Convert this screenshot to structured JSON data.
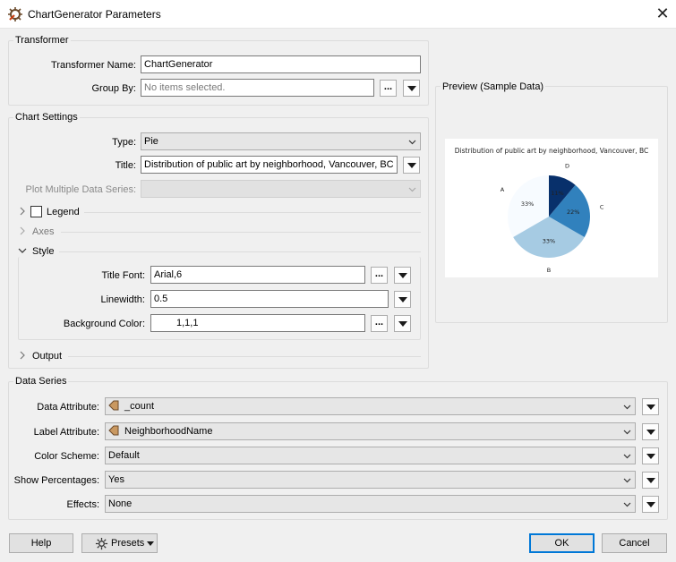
{
  "window": {
    "title": "ChartGenerator Parameters",
    "app_icon": "fme-gear-icon",
    "close_glyph": "✕"
  },
  "transformer": {
    "section_title": "Transformer",
    "name_label": "Transformer Name:",
    "name_value": "ChartGenerator",
    "group_by_label": "Group By:",
    "group_by_placeholder": "No items selected.",
    "ellipsis": "..."
  },
  "chart_settings": {
    "section_title": "Chart Settings",
    "type_label": "Type:",
    "type_value": "Pie",
    "title_label": "Title:",
    "title_value": "Distribution of public art by neighborhood, Vancouver, BC",
    "multi_series_label": "Plot Multiple Data Series:",
    "multi_series_value": "",
    "legend_label": "Legend",
    "legend_checked": false,
    "axes_label": "Axes",
    "style_label": "Style",
    "title_font_label": "Title Font:",
    "title_font_value": "Arial,6",
    "linewidth_label": "Linewidth:",
    "linewidth_value": "0.5",
    "bg_color_label": "Background Color:",
    "bg_color_value": "1,1,1",
    "output_label": "Output"
  },
  "preview": {
    "section_title": "Preview (Sample Data)",
    "chart_title": "Distribution of public art by neighborhood, Vancouver, BC"
  },
  "chart_data": {
    "type": "pie",
    "title": "Distribution of public art by neighborhood, Vancouver, BC",
    "categories": [
      "A",
      "B",
      "C",
      "D"
    ],
    "values": [
      33,
      33,
      22,
      11
    ],
    "value_labels": [
      "33%",
      "33%",
      "22%",
      "11%"
    ],
    "colors": [
      "#f7fbff",
      "#a6cbe3",
      "#3181bd",
      "#08306b"
    ],
    "legend": "none"
  },
  "data_series": {
    "section_title": "Data Series",
    "data_attr_label": "Data Attribute:",
    "data_attr_value": "_count",
    "label_attr_label": "Label Attribute:",
    "label_attr_value": "NeighborhoodName",
    "attr_icon": "attribute-tag-icon",
    "color_scheme_label": "Color Scheme:",
    "color_scheme_value": "Default",
    "show_pct_label": "Show Percentages:",
    "show_pct_value": "Yes",
    "effects_label": "Effects:",
    "effects_value": "None"
  },
  "buttons": {
    "help": "Help",
    "presets": "Presets",
    "ok": "OK",
    "cancel": "Cancel"
  }
}
